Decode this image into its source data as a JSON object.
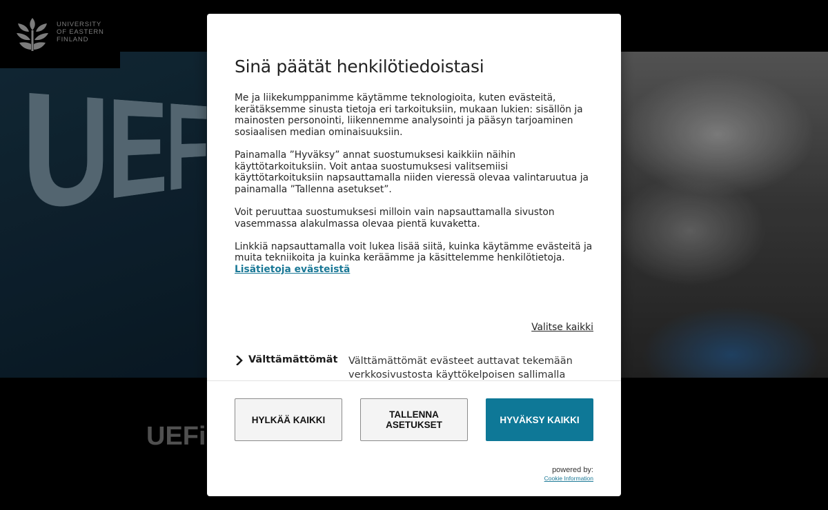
{
  "logo": {
    "line1": "UNIVERSITY",
    "line2": "OF EASTERN",
    "line3": "FINLAND"
  },
  "hero": {
    "graphic_text": "UEF",
    "heading_partial": "UEFi"
  },
  "modal": {
    "title": "Sinä päätät henkilötiedoistasi",
    "paragraphs": [
      "Me ja liikekumppanimme käytämme teknologioita, kuten evästeitä, kerätäksemme sinusta tietoja eri tarkoituksiin, mukaan lukien: sisällön ja mainosten personointi, liikennemme analysointi ja pääsyn tarjoaminen sosiaalisen median ominaisuuksiin.",
      "Painamalla ”Hyväksy” annat suostumuksesi kaikkiin näihin käyttötarkoituksiin. Voit antaa suostumuksesi valitsemiisi käyttötarkoituksiin napsauttamalla niiden vieressä olevaa valintaruutua ja painamalla ”Tallenna asetukset”.",
      "Voit peruuttaa suostumuksesi milloin vain napsauttamalla sivuston vasemmassa alakulmassa olevaa pientä kuvaketta.",
      "Linkkiä napsauttamalla voit lukea lisää siitä, kuinka käytämme evästeitä ja muita tekniikoita ja kuinka keräämme ja käsittelemme henkilötietoja."
    ],
    "more_link": "Lisätietoja evästeistä",
    "select_all": "Valitse kaikki",
    "category": {
      "title": "Välttämättömät",
      "description": "Välttämättömät evästeet auttavat tekemään verkkosivustosta käyttökelpoisen sallimalla"
    },
    "buttons": {
      "reject": "HYLKÄÄ KAIKKI",
      "save_line1": "TALLENNA",
      "save_line2": "ASETUKSET",
      "accept": "HYVÄKSY KAIKKI"
    },
    "powered_by": "powered by:",
    "powered_link": "Cookie Information"
  },
  "colors": {
    "accent": "#0e7897",
    "link": "#1a7896"
  },
  "icons": {
    "logo": "uef-leaf-logo-icon",
    "chevron": "chevron-right-icon"
  }
}
